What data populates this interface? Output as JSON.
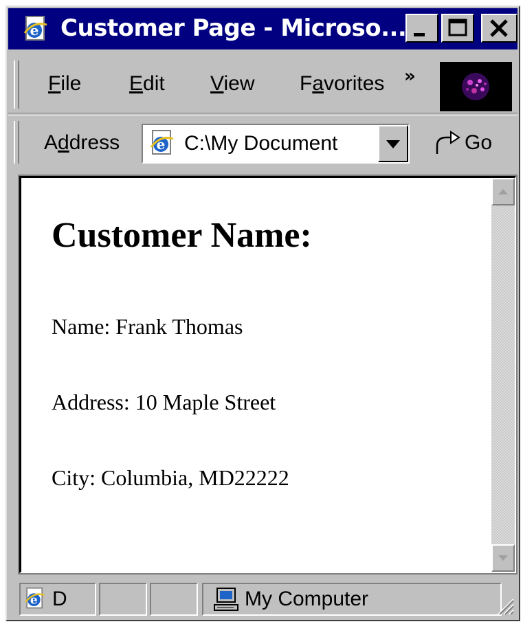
{
  "window": {
    "title": "Customer Page - Microso...",
    "buttons": {
      "minimize": "minimize",
      "maximize": "maximize",
      "close": "close"
    }
  },
  "menubar": {
    "items": [
      {
        "label": "File",
        "accel": "F",
        "rest": "ile"
      },
      {
        "label": "Edit",
        "accel": "E",
        "rest": "dit"
      },
      {
        "label": "View",
        "accel": "V",
        "rest": "iew"
      },
      {
        "label": "Favorites",
        "pre": "F",
        "accel": "a",
        "rest": "vorites"
      }
    ],
    "overflow": "»"
  },
  "addressbar": {
    "label_pre": "A",
    "label_accel": "d",
    "label_rest": "dress",
    "value": "C:\\My Document",
    "go_label": "Go"
  },
  "page": {
    "heading": "Customer Name:",
    "lines": [
      "Name: Frank Thomas",
      "Address: 10 Maple Street",
      "City: Columbia, MD22222"
    ]
  },
  "statusbar": {
    "left_text": "D",
    "zone_text": "My Computer"
  },
  "icons": {
    "title": "ie-page-icon",
    "address": "ie-page-icon",
    "go": "go-arrow-icon",
    "zone": "computer-icon",
    "throbber": "windows-logo-icon"
  },
  "colors": {
    "titlebar": "#000080",
    "chrome": "#c0c0c0",
    "content_bg": "#ffffff"
  }
}
